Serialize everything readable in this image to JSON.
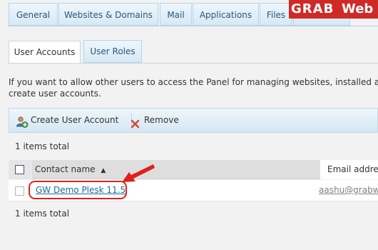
{
  "top_tabs": [
    {
      "label": "General"
    },
    {
      "label": "Websites & Domains"
    },
    {
      "label": "Mail"
    },
    {
      "label": "Applications"
    },
    {
      "label": "Files"
    }
  ],
  "watermark": {
    "brand": "GRAB",
    "suffix": "Web"
  },
  "sub_tabs": [
    {
      "label": "User Accounts",
      "active": true
    },
    {
      "label": "User Roles",
      "active": false
    }
  ],
  "intro_text": {
    "line1": "If you want to allow other users to access the Panel for managing websites, installed app",
    "line2": "create user accounts."
  },
  "toolbar": {
    "create_label": "Create User Account",
    "remove_label": "Remove"
  },
  "summary": {
    "top": "1 items total",
    "bottom": "1 items total"
  },
  "table": {
    "columns": {
      "name": "Contact name",
      "sort_indicator": "▲",
      "email": "Email address"
    },
    "rows": [
      {
        "name": "GW Demo Plesk 11.5",
        "email": "aashu@grabwe"
      }
    ]
  },
  "colors": {
    "accent": "#26577f",
    "link": "#1e6a9c",
    "annotation": "#e0201b",
    "watermark": "#cf2a28"
  },
  "icons": [
    "add-user-icon",
    "remove-x-icon",
    "sort-ascending-icon",
    "annotation-arrow-icon"
  ]
}
